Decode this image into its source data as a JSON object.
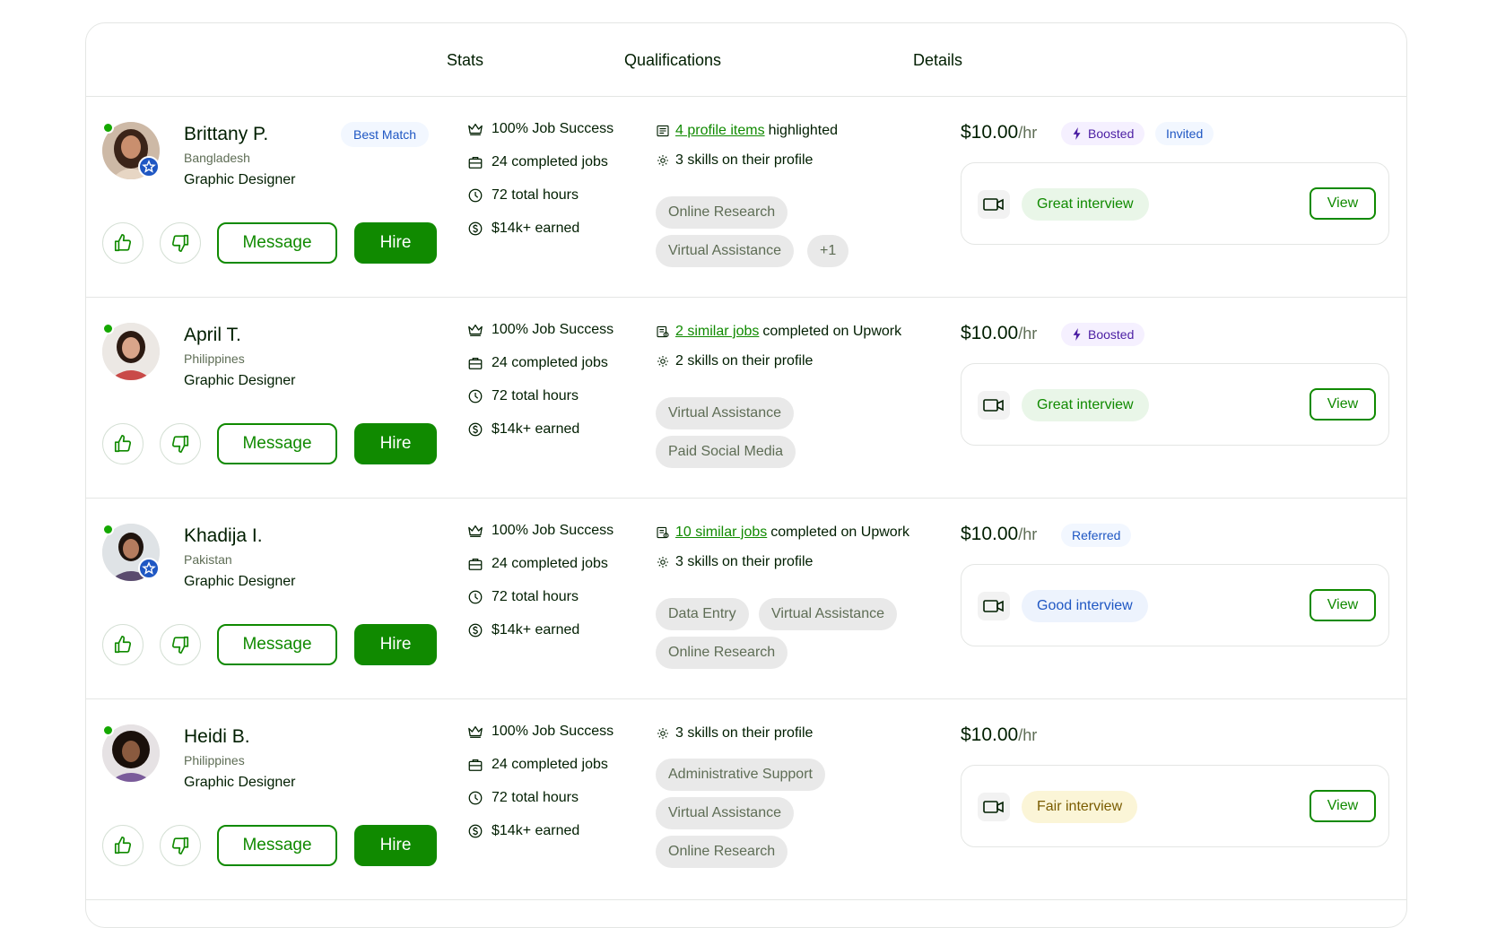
{
  "header": {
    "col_stats": "Stats",
    "col_qualifications": "Qualifications",
    "col_details": "Details"
  },
  "buttons": {
    "message": "Message",
    "hire": "Hire",
    "view": "View"
  },
  "stats_suffix": {
    "job_success": "Job Success",
    "completed_jobs": "completed jobs",
    "total_hours": "total hours",
    "earned": "earned"
  },
  "qual_text": {
    "highlighted": "highlighted",
    "completed_on": "completed on Upwork",
    "skills_suffix": "on their profile"
  },
  "colors": {
    "brand_green": "#108a00",
    "online": "#14a800",
    "blue": "#1f57c3",
    "purple": "#4b1ea3"
  },
  "icons": [
    "thumbs-up-icon",
    "thumbs-down-icon",
    "crown-icon",
    "briefcase-icon",
    "clock-icon",
    "dollar-icon",
    "profile-list-icon",
    "jobs-icon",
    "gear-icon",
    "lightning-icon",
    "video-camera-icon",
    "star-badge-icon"
  ],
  "freelancers": [
    {
      "name": "Brittany P.",
      "country": "Bangladesh",
      "title": "Graphic Designer",
      "best_match": "Best Match",
      "job_success": "100%",
      "completed_jobs": "24",
      "total_hours": "72",
      "earned": "$14k+",
      "qual_link": "4 profile items",
      "skills": "3 skills",
      "chips": [
        "Online Research",
        "Virtual Assistance",
        "+1"
      ],
      "rate": "$10.00",
      "rate_unit": "/hr",
      "pills": [
        "Boosted",
        "Invited"
      ],
      "interview": "Great interview"
    },
    {
      "name": "April T.",
      "country": "Philippines",
      "title": "Graphic Designer",
      "job_success": "100%",
      "completed_jobs": "24",
      "total_hours": "72",
      "earned": "$14k+",
      "qual_link": "2 similar jobs",
      "skills": "2 skills",
      "chips": [
        "Virtual Assistance",
        "Paid Social Media"
      ],
      "rate": "$10.00",
      "rate_unit": "/hr",
      "pills": [
        "Boosted"
      ],
      "interview": "Great interview"
    },
    {
      "name": "Khadija I.",
      "country": "Pakistan",
      "title": "Graphic Designer",
      "job_success": "100%",
      "completed_jobs": "24",
      "total_hours": "72",
      "earned": "$14k+",
      "qual_link": "10 similar jobs",
      "skills": "3 skills",
      "chips": [
        "Data Entry",
        "Virtual Assistance",
        "Online Research"
      ],
      "rate": "$10.00",
      "rate_unit": "/hr",
      "pills": [
        "Referred"
      ],
      "interview": "Good interview"
    },
    {
      "name": "Heidi B.",
      "country": "Philippines",
      "title": "Graphic Designer",
      "job_success": "100%",
      "completed_jobs": "24",
      "total_hours": "72",
      "earned": "$14k+",
      "skills": "3 skills",
      "chips": [
        "Administrative Support",
        "Virtual Assistance",
        "Online Research"
      ],
      "rate": "$10.00",
      "rate_unit": "/hr",
      "pills": [],
      "interview": "Fair interview"
    }
  ]
}
